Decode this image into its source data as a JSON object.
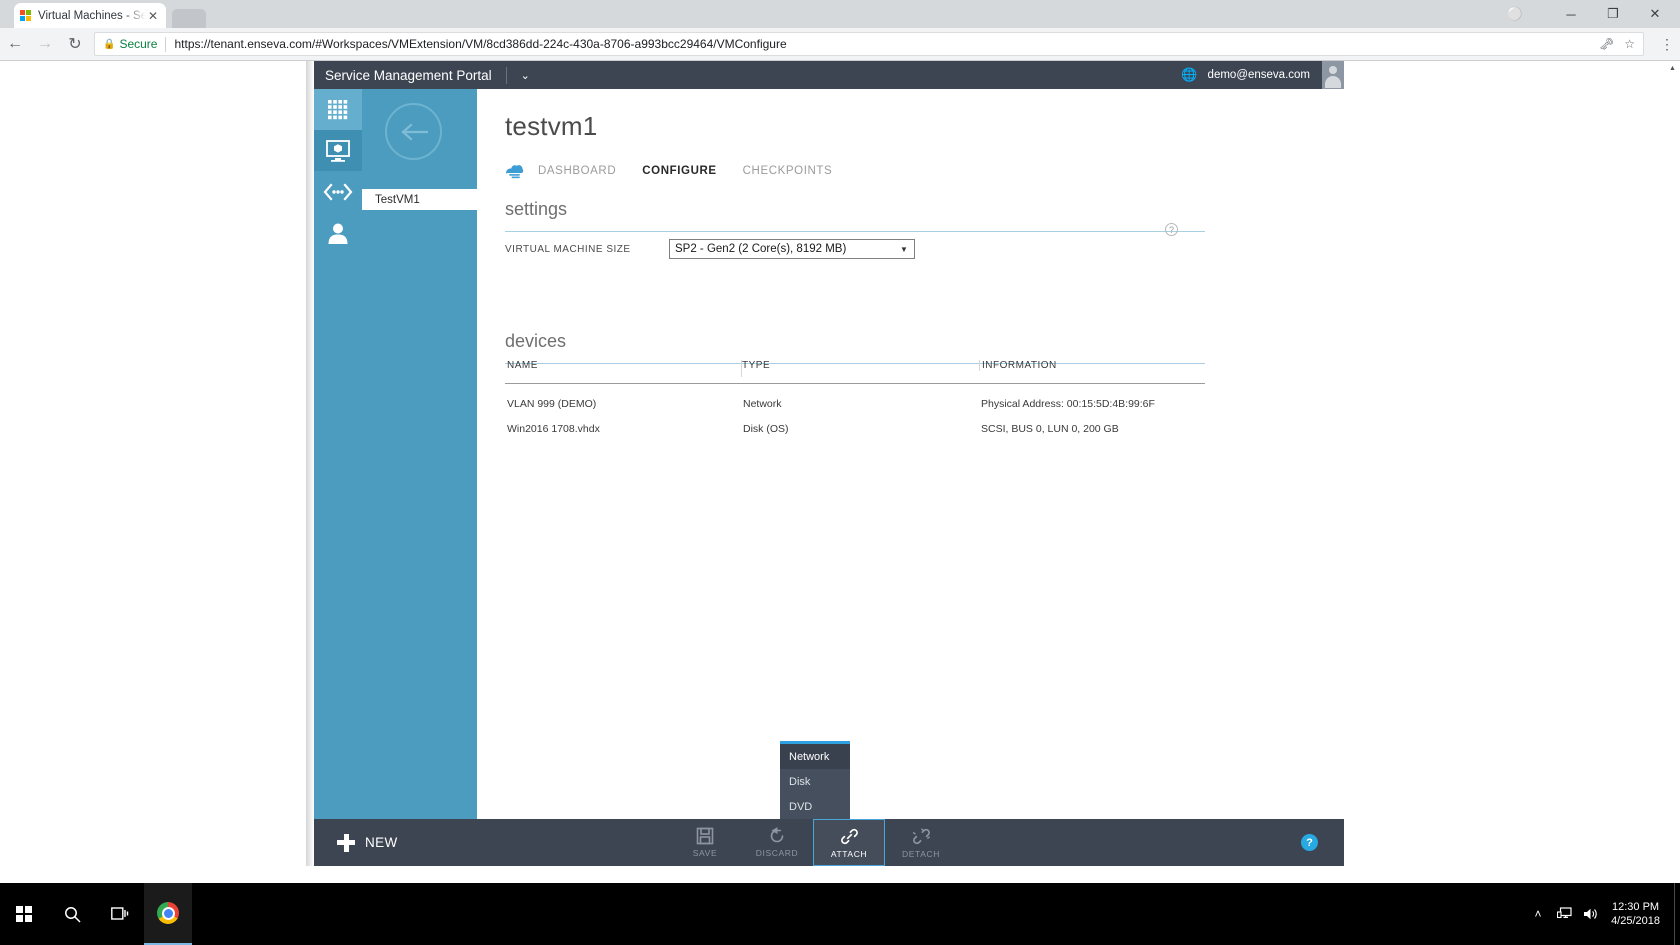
{
  "browser": {
    "tab": {
      "title": "Virtual Machines - Servic",
      "close_label": "✕",
      "favicon": "windows-logo-icon"
    },
    "nav": {
      "back": "←",
      "forward": "→",
      "reload": "↻"
    },
    "omnibox": {
      "lock_icon": "lock-icon",
      "secure_label": "Secure",
      "url": "https://tenant.enseva.com/#Workspaces/VMExtension/VM/8cd386dd-224c-430a-8706-a993bcc29464/VMConfigure",
      "key_icon": "🗝",
      "star_icon": "☆"
    },
    "menu_icon": "⋮",
    "profile_icon": "⚪",
    "window": {
      "minimize": "─",
      "maximize": "❐",
      "close": "✕"
    }
  },
  "portal": {
    "title": "Service Management Portal",
    "chevron": "⌄",
    "globe_icon": "globe-icon",
    "user_email": "demo@enseva.com"
  },
  "rail": {
    "items": [
      {
        "name": "all-items",
        "icon": "grid-icon",
        "state": "selected"
      },
      {
        "name": "virtual-machines",
        "icon": "vm-monitor-icon",
        "state": "active"
      },
      {
        "name": "networks",
        "icon": "network-icon",
        "state": "normal"
      },
      {
        "name": "user-accounts",
        "icon": "user-icon",
        "state": "normal"
      }
    ]
  },
  "panel": {
    "back_label": "back-arrow",
    "item": "TestVM1"
  },
  "main": {
    "vm_name": "testvm1",
    "tabs": [
      {
        "label": "DASHBOARD",
        "active": false
      },
      {
        "label": "CONFIGURE",
        "active": true
      },
      {
        "label": "CHECKPOINTS",
        "active": false
      }
    ],
    "settings": {
      "heading": "settings",
      "help": "?",
      "vm_size_label": "VIRTUAL MACHINE SIZE",
      "vm_size_value": "SP2 - Gen2 (2 Core(s), 8192 MB)",
      "vm_size_caret": "▼"
    },
    "devices": {
      "heading": "devices",
      "columns": [
        "NAME",
        "TYPE",
        "INFORMATION"
      ],
      "rows": [
        {
          "name": "VLAN 999 (DEMO)",
          "type": "Network",
          "information": "Physical Address: 00:15:5D:4B:99:6F"
        },
        {
          "name": "Win2016 1708.vhdx",
          "type": "Disk (OS)",
          "information": "SCSI, BUS 0, LUN 0, 200 GB"
        }
      ]
    }
  },
  "commandbar": {
    "new_label": "NEW",
    "commands": [
      {
        "label": "SAVE",
        "icon": "save-icon",
        "state": "disabled"
      },
      {
        "label": "DISCARD",
        "icon": "discard-icon",
        "state": "disabled"
      },
      {
        "label": "ATTACH",
        "icon": "attach-link-icon",
        "state": "active"
      },
      {
        "label": "DETACH",
        "icon": "detach-link-icon",
        "state": "disabled"
      }
    ],
    "help_label": "?"
  },
  "attach_menu": {
    "items": [
      {
        "label": "Network",
        "hover": true
      },
      {
        "label": "Disk",
        "hover": false
      },
      {
        "label": "DVD",
        "hover": false
      }
    ]
  },
  "taskbar": {
    "start_icon": "windows-start-icon",
    "search_icon": "search-icon",
    "taskview_icon": "task-view-icon",
    "chrome_icon": "chrome-icon",
    "tray": {
      "chevron": "˄",
      "network_icon": "network-tray-icon",
      "volume_icon": "volume-icon"
    },
    "time": "12:30 PM",
    "date": "4/25/2018"
  },
  "colors": {
    "accent_blue": "#4c9cbf",
    "dark_navy": "#3e4552",
    "attach_border": "#4aa5db",
    "popup_top": "#2fa1e0"
  }
}
